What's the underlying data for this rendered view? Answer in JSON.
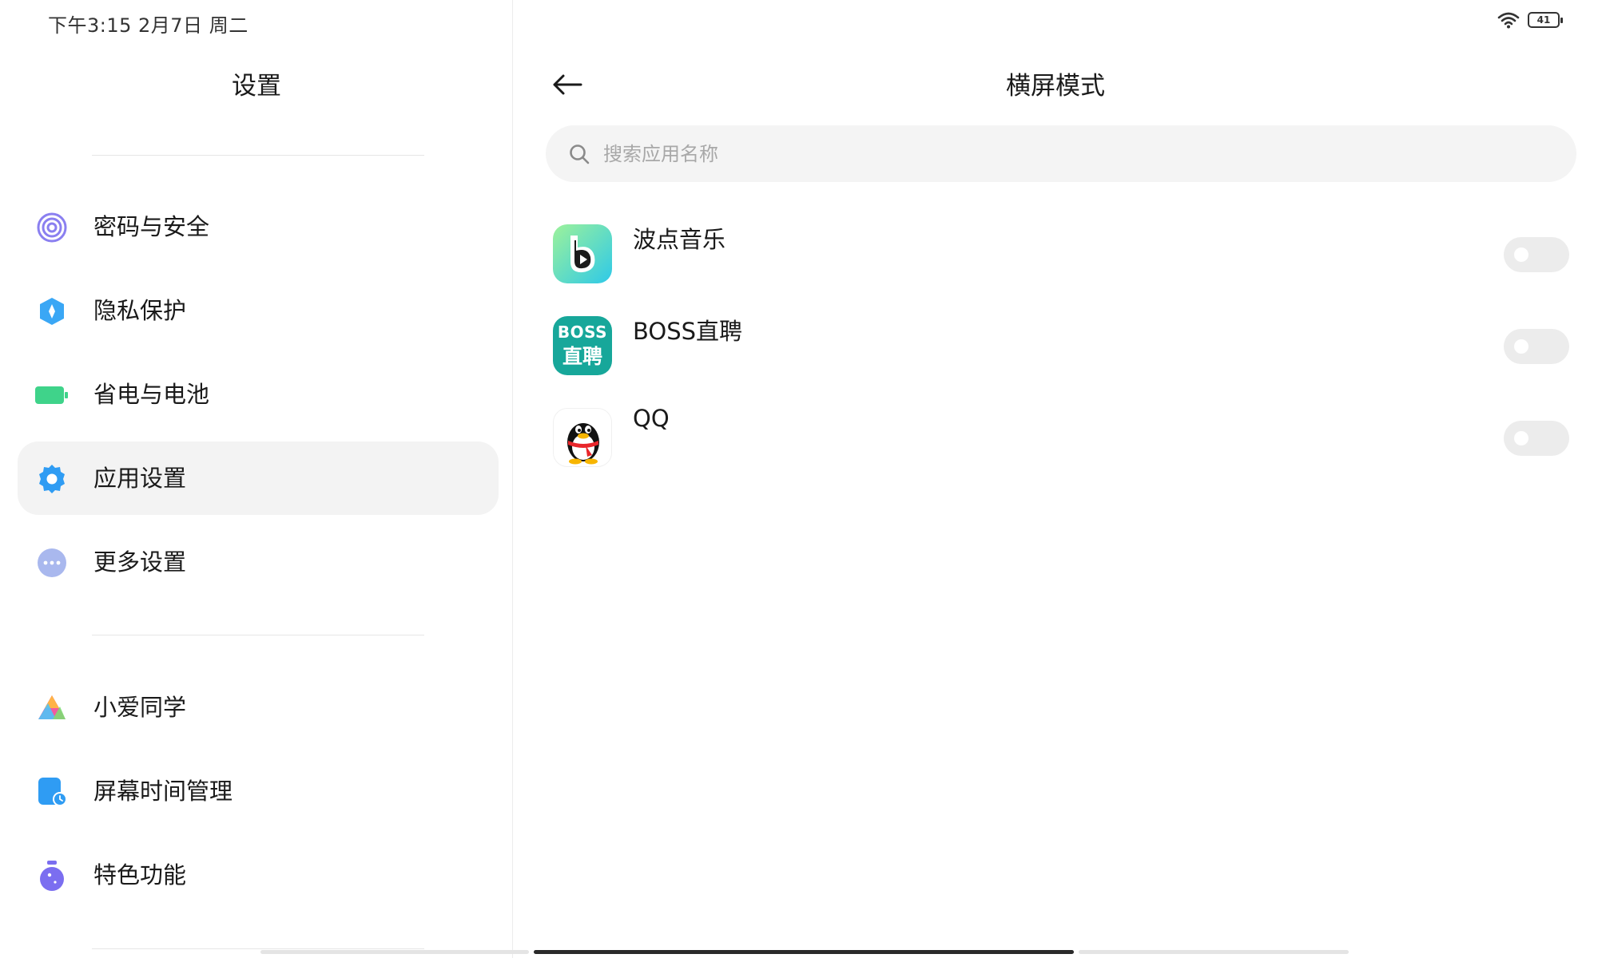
{
  "status_bar": {
    "time": "下午3:15  2月7日 周二",
    "battery": "41",
    "wifi_icon": "wifi-icon"
  },
  "left_pane": {
    "title": "设置",
    "items": [
      {
        "label": "密码与安全",
        "icon": "fingerprint-icon",
        "active": false
      },
      {
        "label": "隐私保护",
        "icon": "privacy-shield-icon",
        "active": false
      },
      {
        "label": "省电与电池",
        "icon": "battery-icon",
        "active": false
      },
      {
        "label": "应用设置",
        "icon": "gear-icon",
        "active": true
      },
      {
        "label": "更多设置",
        "icon": "more-dots-icon",
        "active": false
      },
      {
        "label": "小爱同学",
        "icon": "xiaoai-icon",
        "active": false
      },
      {
        "label": "屏幕时间管理",
        "icon": "screen-time-icon",
        "active": false
      },
      {
        "label": "特色功能",
        "icon": "features-icon",
        "active": false
      }
    ]
  },
  "main": {
    "title": "横屏模式",
    "back_icon": "back-arrow-icon",
    "search": {
      "placeholder": "搜索应用名称",
      "value": ""
    },
    "apps": [
      {
        "name": "波点音乐",
        "icon": "bodian-music-icon",
        "enabled": false
      },
      {
        "name": "BOSS直聘",
        "icon": "boss-zhipin-icon",
        "icon_text_top": "BOSS",
        "icon_text_bottom": "直聘",
        "enabled": false
      },
      {
        "name": "QQ",
        "icon": "qq-penguin-icon",
        "enabled": false
      }
    ]
  },
  "colors": {
    "active_bg": "#f3f3f3",
    "toggle_off": "#ececec",
    "boss_teal": "#17a79a",
    "bodian_gradient_start": "#8ef0a0",
    "bodian_gradient_end": "#36d0e6"
  }
}
